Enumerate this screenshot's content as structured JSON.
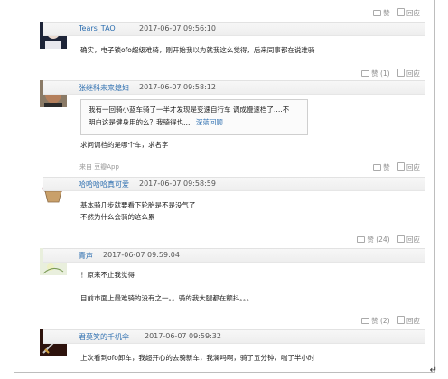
{
  "top_actions": {
    "like_label": "赞",
    "reply_label": "回应"
  },
  "comments": [
    {
      "username": "Tears_TAO",
      "timestamp": "2017-06-07 09:56:10",
      "text_lines": [
        "确实，电子锁ofo超级难骑，刚开始我以为就我这么觉得，后来同事都在说难骑"
      ],
      "like_label": "赞 (1)",
      "reply_label": "回应"
    },
    {
      "username": "张继科未来媳妇",
      "timestamp": "2017-06-07 09:58:12",
      "quote_line1": "我有一回骑小蓝车骑了一半才发现是变速自行车 调成慢速档了….不",
      "quote_line2": "明白这是健身用的么？我骑得也…",
      "quote_link": "深蓝回顾",
      "text_lines": [
        "求问调档的是哪个车，求名字"
      ],
      "source": "来自 豆瓣App",
      "like_label": "赞",
      "reply_label": "回应"
    },
    {
      "username": "哈哈哈哈真可爱",
      "timestamp": "2017-06-07 09:58:59",
      "text_lines": [
        "基本骑几步就要看下轮胎是不是没气了",
        "不然为什么会骑的这么累"
      ],
      "like_label": "赞 (24)",
      "reply_label": "回应"
    },
    {
      "username": "青声",
      "timestamp": "2017-06-07 09:59:04",
      "text_lines": [
        "！原来不止我觉得",
        "目前市面上最难骑的没有之一。。骑的我大腿都在颤抖。。。"
      ],
      "like_label": "赞 (2)",
      "reply_label": "回应"
    },
    {
      "username": "君莫笑的千机伞",
      "timestamp": "2017-06-07 09:59:32",
      "text_lines": [
        "上次看到ofo卸车，我超开心的去骑新车，我澜吗啊，骑了五分钟，喘了半小时"
      ],
      "like_label": "",
      "reply_label": ""
    }
  ],
  "return_symbol": "↵",
  "colors": {
    "link": "#2e6fb0",
    "bar": "#f2f2f2",
    "muted": "#8a8a8a"
  }
}
